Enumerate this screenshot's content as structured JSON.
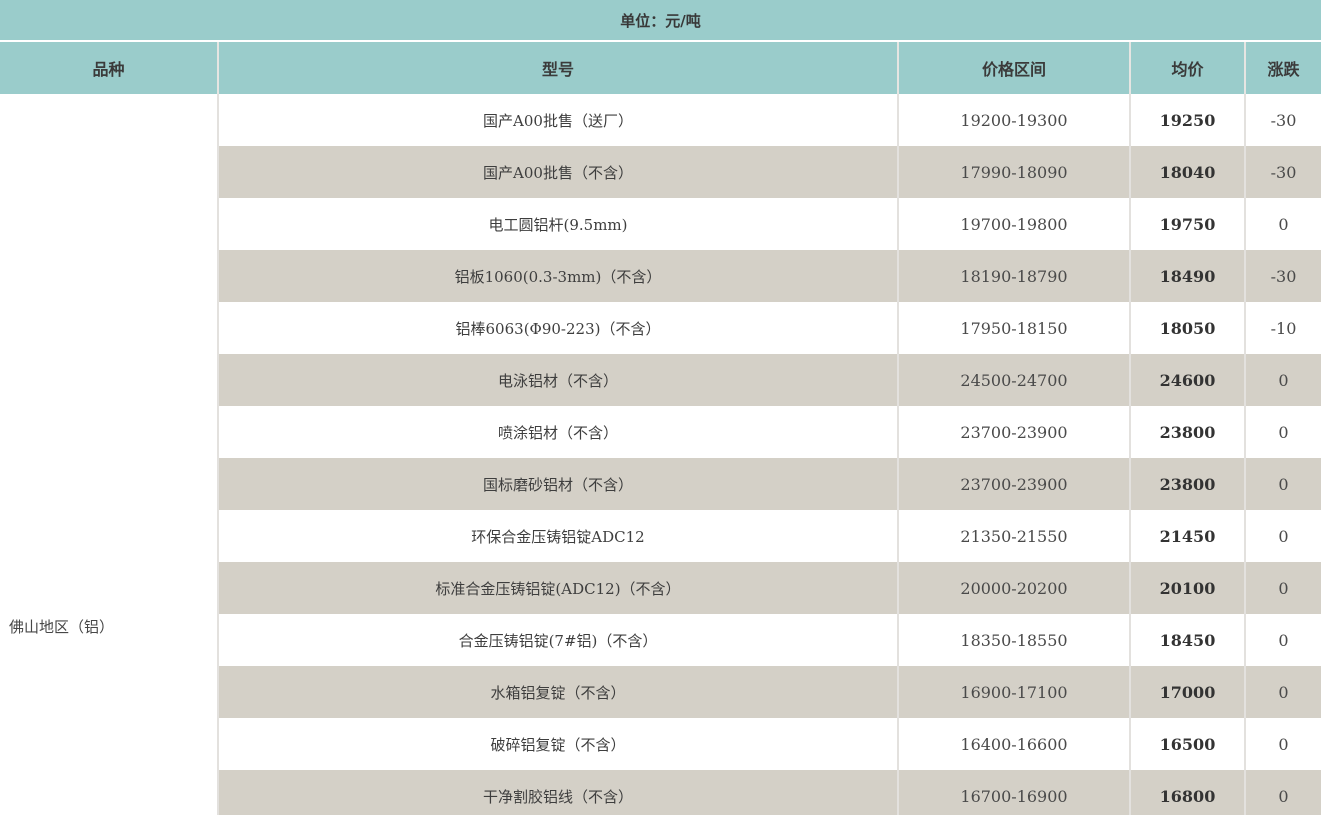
{
  "unit": {
    "label": "单位：元/吨"
  },
  "table": {
    "headers": {
      "variety": "品种",
      "model": "型号",
      "range": "价格区间",
      "avg": "均价",
      "change": "涨跌"
    },
    "region": "佛山地区（铝）",
    "rows": [
      {
        "model": "国产A00批售（送厂）",
        "range": "19200-19300",
        "avg": "19250",
        "change": "-30"
      },
      {
        "model": "国产A00批售（不含）",
        "range": "17990-18090",
        "avg": "18040",
        "change": "-30"
      },
      {
        "model": "电工圆铝杆(9.5mm)",
        "range": "19700-19800",
        "avg": "19750",
        "change": "0"
      },
      {
        "model": "铝板1060(0.3-3mm)（不含）",
        "range": "18190-18790",
        "avg": "18490",
        "change": "-30"
      },
      {
        "model": "铝棒6063(Φ90-223)（不含）",
        "range": "17950-18150",
        "avg": "18050",
        "change": "-10"
      },
      {
        "model": "电泳铝材（不含）",
        "range": "24500-24700",
        "avg": "24600",
        "change": "0"
      },
      {
        "model": "喷涂铝材（不含）",
        "range": "23700-23900",
        "avg": "23800",
        "change": "0"
      },
      {
        "model": "国标磨砂铝材（不含）",
        "range": "23700-23900",
        "avg": "23800",
        "change": "0"
      },
      {
        "model": "环保合金压铸铝锭ADC12",
        "range": "21350-21550",
        "avg": "21450",
        "change": "0"
      },
      {
        "model": "标准合金压铸铝锭(ADC12)（不含）",
        "range": "20000-20200",
        "avg": "20100",
        "change": "0"
      },
      {
        "model": "合金压铸铝锭(7#铝)（不含）",
        "range": "18350-18550",
        "avg": "18450",
        "change": "0"
      },
      {
        "model": "水箱铝复锭（不含）",
        "range": "16900-17100",
        "avg": "17000",
        "change": "0"
      },
      {
        "model": "破碎铝复锭（不含）",
        "range": "16400-16600",
        "avg": "16500",
        "change": "0"
      },
      {
        "model": "干净割胶铝线（不含）",
        "range": "16700-16900",
        "avg": "16800",
        "change": "0"
      }
    ]
  },
  "colors": {
    "header_bg": "#9acccb",
    "row_alt_bg": "#d4d0c7",
    "row_bg": "#ffffff",
    "text": "#3e3e3e",
    "divider": "#e3e1de"
  },
  "chart_data": {
    "type": "table",
    "title": "单位：元/吨",
    "columns": [
      "品种",
      "型号",
      "价格区间",
      "均价",
      "涨跌"
    ],
    "region": "佛山地区（铝）",
    "rows": [
      [
        "国产A00批售（送厂）",
        "19200-19300",
        19250,
        -30
      ],
      [
        "国产A00批售（不含）",
        "17990-18090",
        18040,
        -30
      ],
      [
        "电工圆铝杆(9.5mm)",
        "19700-19800",
        19750,
        0
      ],
      [
        "铝板1060(0.3-3mm)（不含）",
        "18190-18790",
        18490,
        -30
      ],
      [
        "铝棒6063(Φ90-223)（不含）",
        "17950-18150",
        18050,
        -10
      ],
      [
        "电泳铝材（不含）",
        "24500-24700",
        24600,
        0
      ],
      [
        "喷涂铝材（不含）",
        "23700-23900",
        23800,
        0
      ],
      [
        "国标磨砂铝材（不含）",
        "23700-23900",
        23800,
        0
      ],
      [
        "环保合金压铸铝锭ADC12",
        "21350-21550",
        21450,
        0
      ],
      [
        "标准合金压铸铝锭(ADC12)（不含）",
        "20000-20200",
        20100,
        0
      ],
      [
        "合金压铸铝锭(7#铝)（不含）",
        "18350-18550",
        18450,
        0
      ],
      [
        "水箱铝复锭（不含）",
        "16900-17100",
        17000,
        0
      ],
      [
        "破碎铝复锭（不含）",
        "16400-16600",
        16500,
        0
      ],
      [
        "干净割胶铝线（不含）",
        "16700-16900",
        16800,
        0
      ]
    ]
  }
}
